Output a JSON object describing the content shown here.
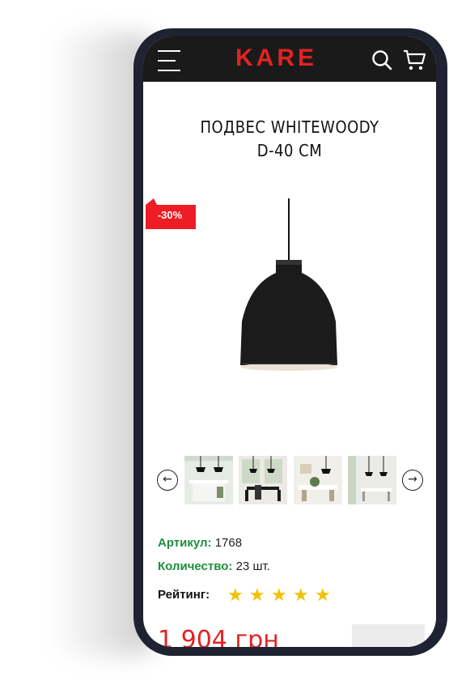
{
  "header": {
    "logo": "KARE",
    "menu_icon": "hamburger-icon",
    "search_icon": "search-icon",
    "cart_icon": "cart-icon",
    "background": "#1a1a1a",
    "brand_color": "#e32222"
  },
  "product": {
    "title_line1": "ПОДВЕС WHITEWOODY",
    "title_line2": "D-40 СМ",
    "discount_badge": "-30%",
    "sku_label": "Артикул:",
    "sku_value": "1768",
    "qty_label": "Количество:",
    "qty_value": "23 шт.",
    "rating_label": "Рейтинг:",
    "rating": 5,
    "price": "1 904 грн",
    "accent_green": "#1e8e3e",
    "star_color": "#f2c200"
  },
  "gallery": {
    "prev_icon": "arrow-left-icon",
    "next_icon": "arrow-right-icon",
    "thumbnails": [
      "room-thumbnail-1",
      "room-thumbnail-2",
      "room-thumbnail-3",
      "room-thumbnail-4"
    ]
  }
}
